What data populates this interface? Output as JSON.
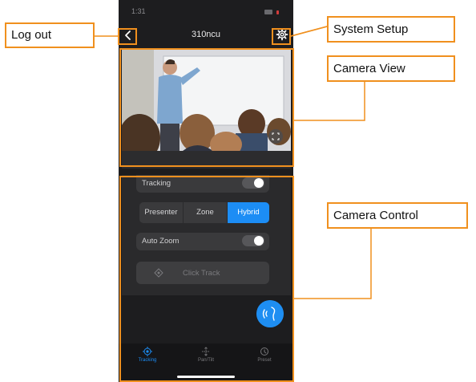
{
  "status_bar": {
    "time": "1:31"
  },
  "nav": {
    "title": "310ncu",
    "back_icon": "chevron-left-icon",
    "settings_icon": "gear-icon"
  },
  "controls": {
    "tracking_label": "Tracking",
    "tracking_on": false,
    "modes": [
      "Presenter",
      "Zone",
      "Hybrid"
    ],
    "active_mode": "Hybrid",
    "auto_zoom_label": "Auto Zoom",
    "auto_zoom_on": false,
    "click_track_label": "Click Track"
  },
  "tabs": [
    {
      "label": "Tracking",
      "icon": "target-icon",
      "active": true
    },
    {
      "label": "Pan/Tilt",
      "icon": "move-icon",
      "active": false
    },
    {
      "label": "Preset",
      "icon": "preset-icon",
      "active": false
    }
  ],
  "annotations": {
    "logout": "Log out",
    "system_setup": "System Setup",
    "camera_view": "Camera View",
    "camera_control": "Camera Control"
  },
  "colors": {
    "accent": "#1c8df5",
    "annotation": "#f0901e"
  }
}
